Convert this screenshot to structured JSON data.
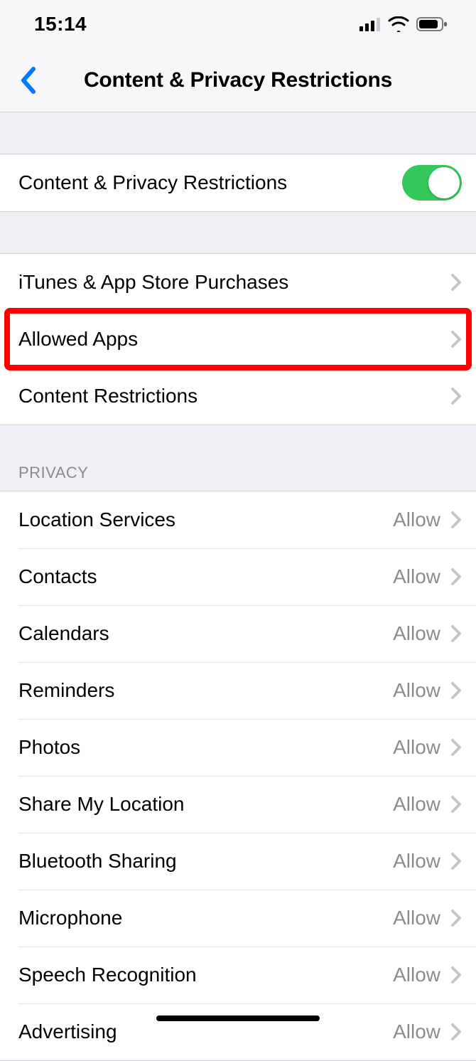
{
  "status": {
    "time": "15:14"
  },
  "nav": {
    "title": "Content & Privacy Restrictions"
  },
  "toggleRow": {
    "label": "Content & Privacy Restrictions",
    "on": true
  },
  "group1": [
    {
      "label": "iTunes & App Store Purchases"
    },
    {
      "label": "Allowed Apps"
    },
    {
      "label": "Content Restrictions"
    }
  ],
  "privacyHeader": "PRIVACY",
  "privacyRows": [
    {
      "label": "Location Services",
      "value": "Allow"
    },
    {
      "label": "Contacts",
      "value": "Allow"
    },
    {
      "label": "Calendars",
      "value": "Allow"
    },
    {
      "label": "Reminders",
      "value": "Allow"
    },
    {
      "label": "Photos",
      "value": "Allow"
    },
    {
      "label": "Share My Location",
      "value": "Allow"
    },
    {
      "label": "Bluetooth Sharing",
      "value": "Allow"
    },
    {
      "label": "Microphone",
      "value": "Allow"
    },
    {
      "label": "Speech Recognition",
      "value": "Allow"
    },
    {
      "label": "Advertising",
      "value": "Allow"
    }
  ],
  "highlightIndex": 1
}
